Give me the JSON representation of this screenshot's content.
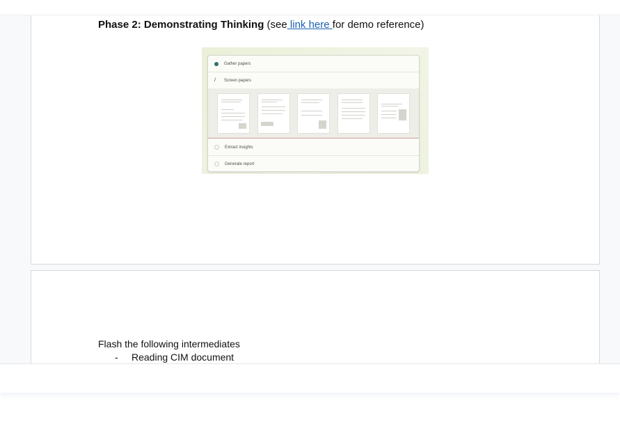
{
  "doc": {
    "phase": {
      "title": "Phase 2: Demonstrating Thinking",
      "see_prefix": "(see",
      "link_text": " link here ",
      "see_suffix": "for demo reference)"
    },
    "demo": {
      "steps": [
        {
          "label": "Gather papers",
          "state": "done"
        },
        {
          "label": "Screen papers",
          "state": "active"
        },
        {
          "label": "Extract insights",
          "state": "pending"
        },
        {
          "label": "Generate report",
          "state": "pending"
        }
      ]
    },
    "flash": {
      "heading": "Flash the following intermediates",
      "items": [
        "Reading CIM document"
      ],
      "bullet_marker": "-"
    }
  },
  "colors": {
    "link": "#1a5fb4",
    "check": "#2f6f6a",
    "divider": "#d59a9a"
  }
}
